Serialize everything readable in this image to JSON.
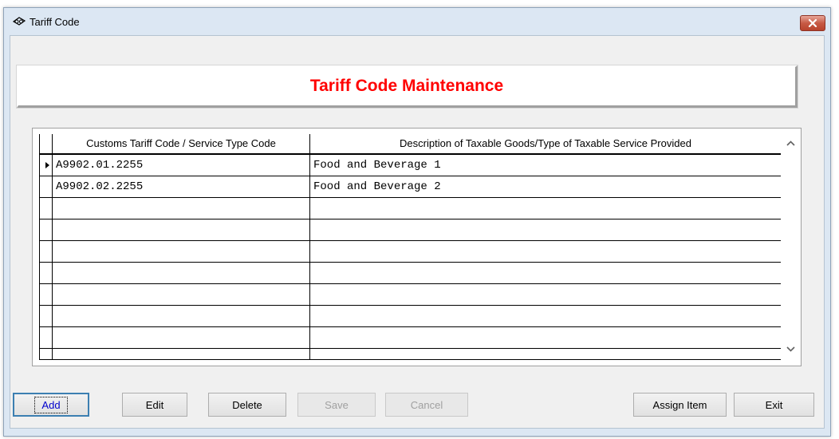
{
  "window": {
    "title": "Tariff Code",
    "banner_title": "Tariff Code Maintenance"
  },
  "grid": {
    "columns": [
      "Customs Tariff Code / Service Type Code",
      "Description of Taxable Goods/Type of Taxable Service Provided"
    ],
    "rows": [
      {
        "code": "A9902.01.2255",
        "description": "Food and Beverage 1"
      },
      {
        "code": "A9902.02.2255",
        "description": "Food and Beverage 2"
      },
      {
        "code": "",
        "description": ""
      },
      {
        "code": "",
        "description": ""
      },
      {
        "code": "",
        "description": ""
      },
      {
        "code": "",
        "description": ""
      },
      {
        "code": "",
        "description": ""
      },
      {
        "code": "",
        "description": ""
      },
      {
        "code": "",
        "description": ""
      },
      {
        "code": "",
        "description": ""
      }
    ]
  },
  "buttons": {
    "add": "Add",
    "edit": "Edit",
    "delete": "Delete",
    "save": "Save",
    "cancel": "Cancel",
    "assign_item": "Assign Item",
    "exit": "Exit"
  },
  "icons": {
    "title": "eye-glasses-icon",
    "close": "close-icon",
    "row_pointer": "row-pointer-icon",
    "scroll_up": "chevron-up-icon",
    "scroll_down": "chevron-down-icon"
  },
  "colors": {
    "banner_title": "#ff0000",
    "close_button": "#c75a45",
    "focus_border": "#3c7fb1"
  }
}
